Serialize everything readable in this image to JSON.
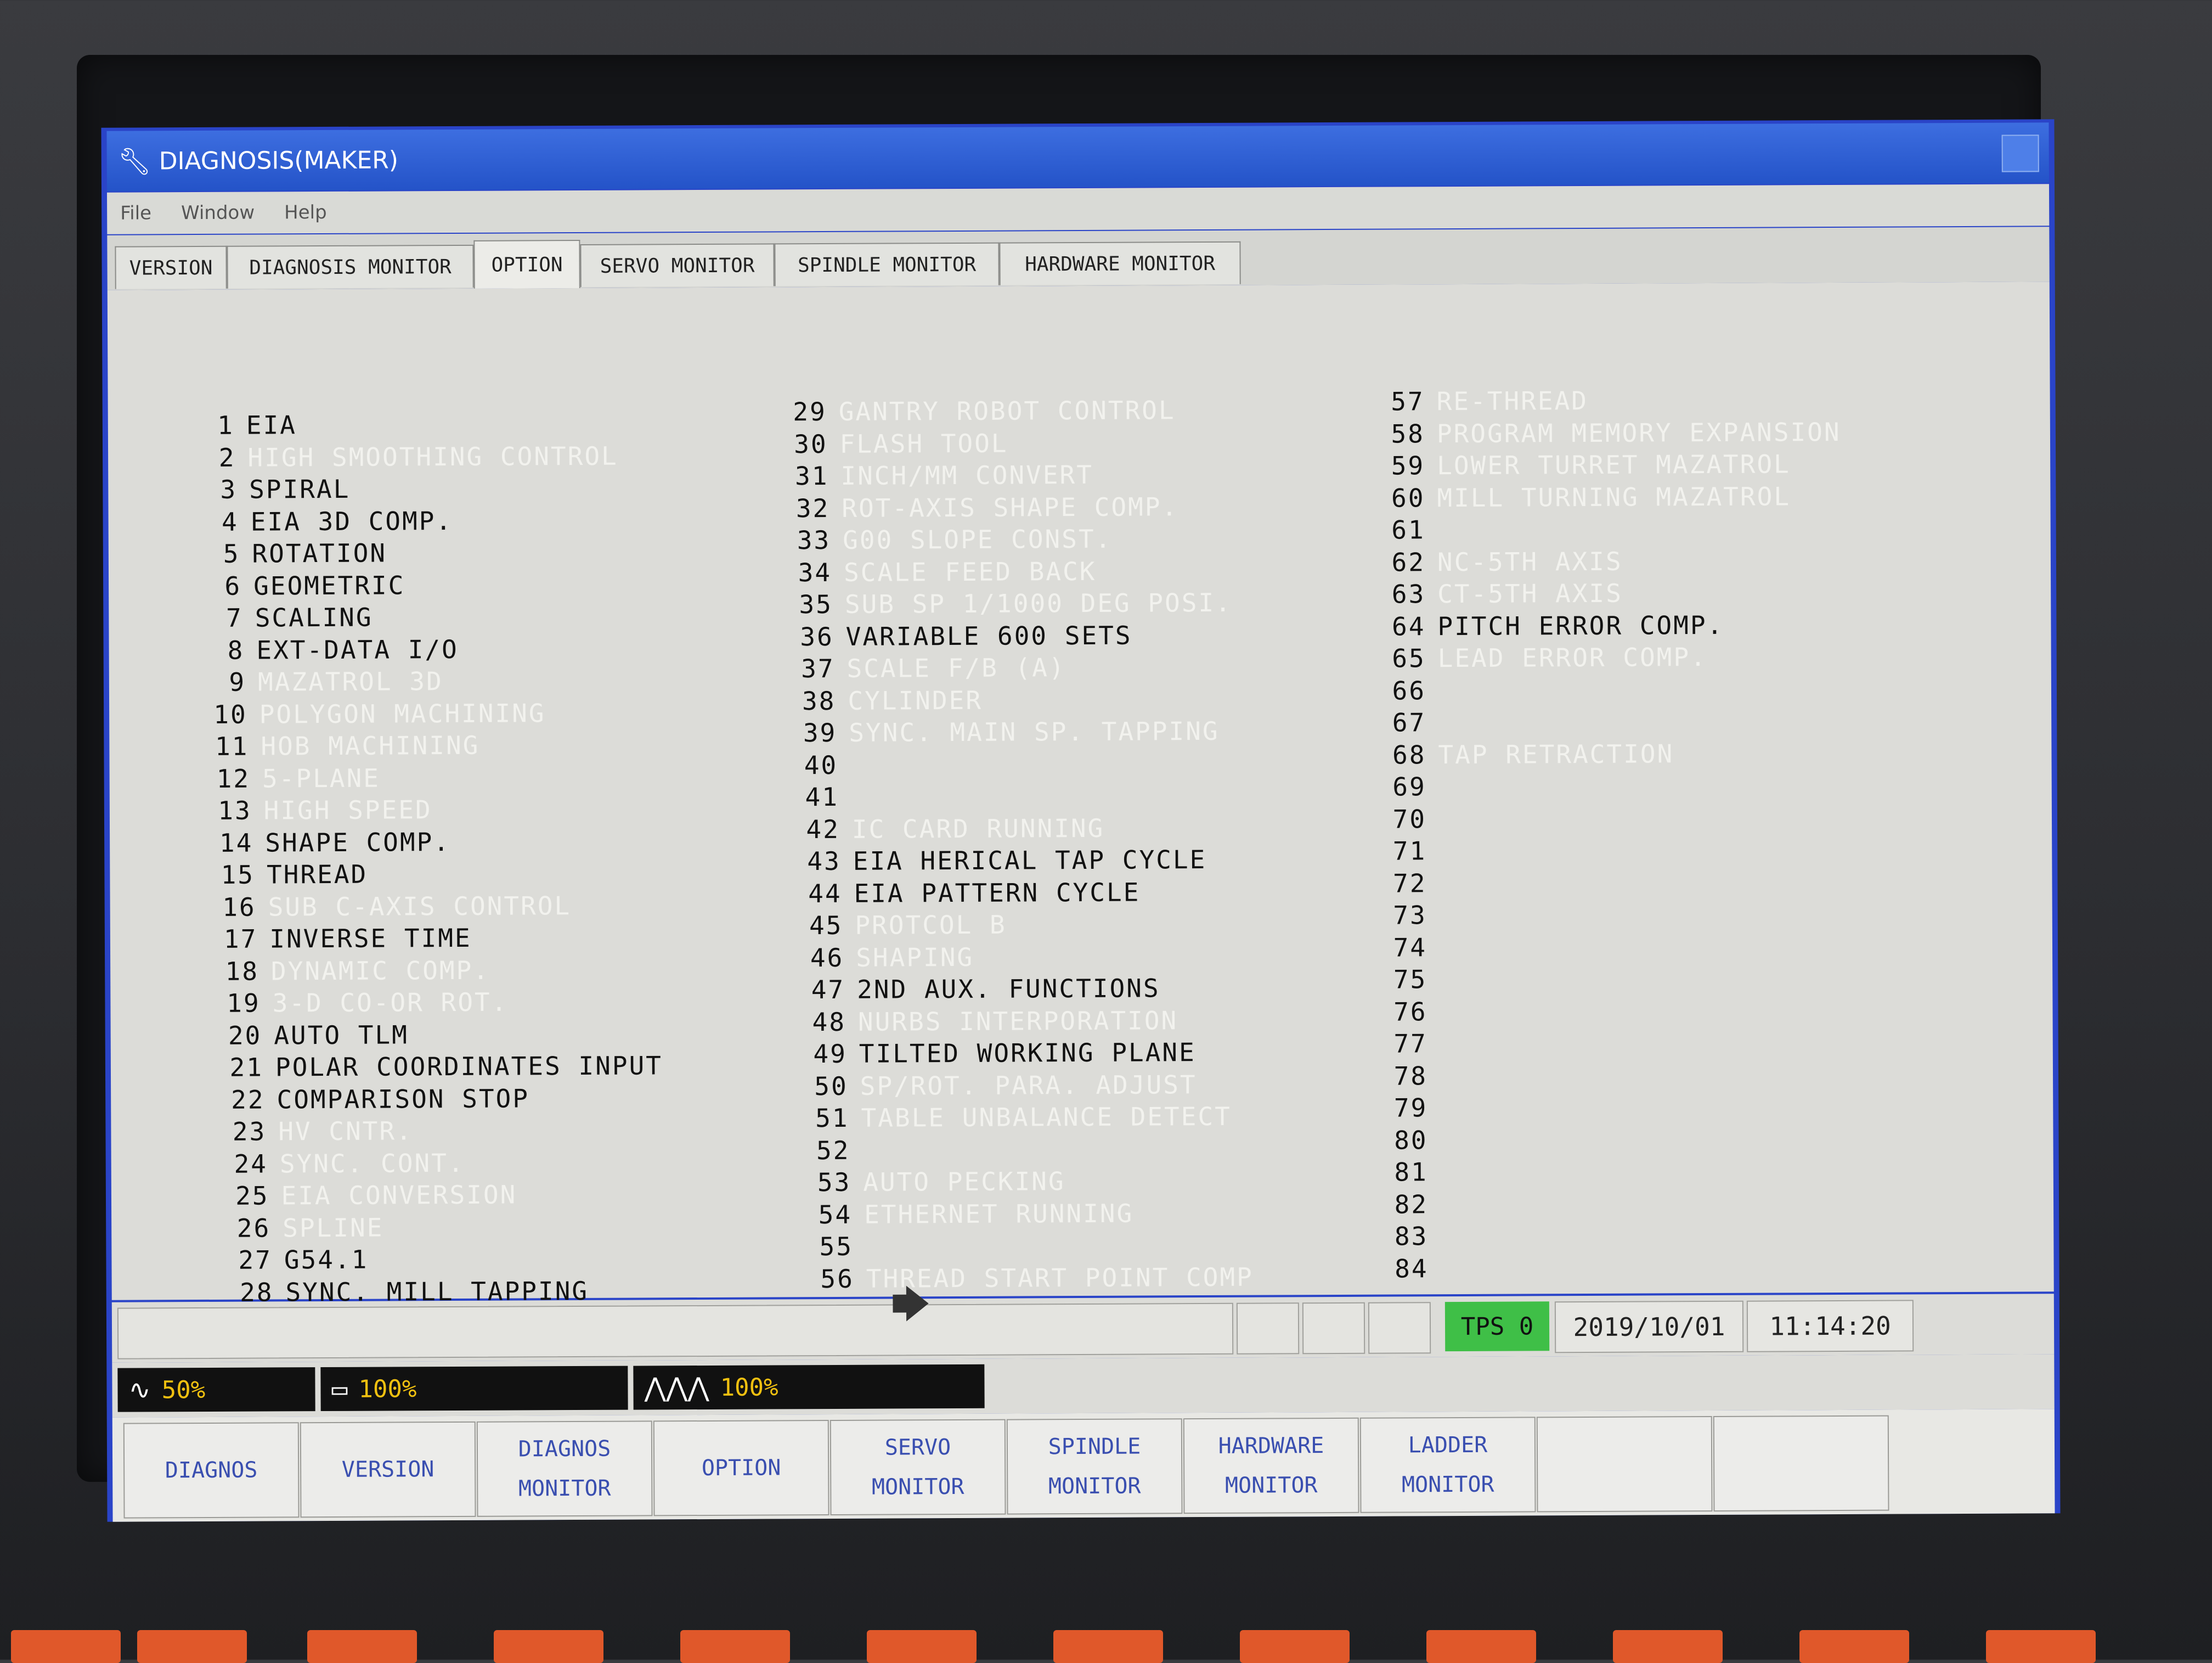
{
  "window": {
    "title": "DIAGNOSIS(MAKER)",
    "icon": "wrench-icon"
  },
  "menu": [
    "File",
    "Window",
    "Help"
  ],
  "tabs": [
    {
      "label": "VERSION",
      "active": false
    },
    {
      "label": "DIAGNOSIS MONITOR",
      "active": false
    },
    {
      "label": "OPTION",
      "active": true
    },
    {
      "label": "SERVO MONITOR",
      "active": false
    },
    {
      "label": "SPINDLE MONITOR",
      "active": false
    },
    {
      "label": "HARDWARE MONITOR",
      "active": false
    }
  ],
  "options": [
    {
      "num": "1",
      "label": "EIA",
      "enabled": true
    },
    {
      "num": "2",
      "label": "HIGH SMOOTHING CONTROL",
      "enabled": false
    },
    {
      "num": "3",
      "label": "SPIRAL",
      "enabled": true
    },
    {
      "num": "4",
      "label": "EIA 3D COMP.",
      "enabled": true
    },
    {
      "num": "5",
      "label": "ROTATION",
      "enabled": true
    },
    {
      "num": "6",
      "label": "GEOMETRIC",
      "enabled": true
    },
    {
      "num": "7",
      "label": "SCALING",
      "enabled": true
    },
    {
      "num": "8",
      "label": "EXT-DATA I/O",
      "enabled": true
    },
    {
      "num": "9",
      "label": "MAZATROL 3D",
      "enabled": false
    },
    {
      "num": "10",
      "label": "POLYGON MACHINING",
      "enabled": false
    },
    {
      "num": "11",
      "label": "HOB MACHINING",
      "enabled": false
    },
    {
      "num": "12",
      "label": "5-PLANE",
      "enabled": false
    },
    {
      "num": "13",
      "label": "HIGH SPEED",
      "enabled": false
    },
    {
      "num": "14",
      "label": "SHAPE COMP.",
      "enabled": true
    },
    {
      "num": "15",
      "label": "THREAD",
      "enabled": true
    },
    {
      "num": "16",
      "label": "SUB C-AXIS CONTROL",
      "enabled": false
    },
    {
      "num": "17",
      "label": "INVERSE TIME",
      "enabled": true
    },
    {
      "num": "18",
      "label": "DYNAMIC COMP.",
      "enabled": false
    },
    {
      "num": "19",
      "label": "3-D CO-OR ROT.",
      "enabled": false
    },
    {
      "num": "20",
      "label": "AUTO TLM",
      "enabled": true
    },
    {
      "num": "21",
      "label": "POLAR COORDINATES INPUT",
      "enabled": true
    },
    {
      "num": "22",
      "label": "COMPARISON STOP",
      "enabled": true
    },
    {
      "num": "23",
      "label": "HV CNTR.",
      "enabled": false
    },
    {
      "num": "24",
      "label": "SYNC. CONT.",
      "enabled": false
    },
    {
      "num": "25",
      "label": "EIA CONVERSION",
      "enabled": false
    },
    {
      "num": "26",
      "label": "SPLINE",
      "enabled": false
    },
    {
      "num": "27",
      "label": "G54.1",
      "enabled": true
    },
    {
      "num": "28",
      "label": "SYNC. MILL TAPPING",
      "enabled": true
    },
    {
      "num": "29",
      "label": "GANTRY ROBOT CONTROL",
      "enabled": false
    },
    {
      "num": "30",
      "label": "FLASH TOOL",
      "enabled": false
    },
    {
      "num": "31",
      "label": "INCH/MM CONVERT",
      "enabled": false
    },
    {
      "num": "32",
      "label": "ROT-AXIS SHAPE COMP.",
      "enabled": false
    },
    {
      "num": "33",
      "label": "G00 SLOPE CONST.",
      "enabled": false
    },
    {
      "num": "34",
      "label": "SCALE FEED BACK",
      "enabled": false
    },
    {
      "num": "35",
      "label": "SUB SP 1/1000 DEG POSI.",
      "enabled": false
    },
    {
      "num": "36",
      "label": "VARIABLE 600 SETS",
      "enabled": true
    },
    {
      "num": "37",
      "label": "SCALE F/B (A)",
      "enabled": false
    },
    {
      "num": "38",
      "label": "CYLINDER",
      "enabled": false
    },
    {
      "num": "39",
      "label": "SYNC. MAIN SP. TAPPING",
      "enabled": false
    },
    {
      "num": "40",
      "label": "",
      "enabled": false
    },
    {
      "num": "41",
      "label": "",
      "enabled": false
    },
    {
      "num": "42",
      "label": "IC CARD RUNNING",
      "enabled": false
    },
    {
      "num": "43",
      "label": "EIA HERICAL TAP CYCLE",
      "enabled": true
    },
    {
      "num": "44",
      "label": "EIA PATTERN CYCLE",
      "enabled": true
    },
    {
      "num": "45",
      "label": "PROTCOL B",
      "enabled": false
    },
    {
      "num": "46",
      "label": "SHAPING",
      "enabled": false
    },
    {
      "num": "47",
      "label": "2ND AUX. FUNCTIONS",
      "enabled": true
    },
    {
      "num": "48",
      "label": "NURBS INTERPORATION",
      "enabled": false
    },
    {
      "num": "49",
      "label": "TILTED WORKING PLANE",
      "enabled": true
    },
    {
      "num": "50",
      "label": "SP/ROT. PARA. ADJUST",
      "enabled": false
    },
    {
      "num": "51",
      "label": "TABLE UNBALANCE DETECT",
      "enabled": false
    },
    {
      "num": "52",
      "label": "",
      "enabled": false
    },
    {
      "num": "53",
      "label": "AUTO PECKING",
      "enabled": false
    },
    {
      "num": "54",
      "label": "ETHERNET RUNNING",
      "enabled": false
    },
    {
      "num": "55",
      "label": "",
      "enabled": false
    },
    {
      "num": "56",
      "label": "THREAD START POINT COMP",
      "enabled": false
    },
    {
      "num": "57",
      "label": "RE-THREAD",
      "enabled": false
    },
    {
      "num": "58",
      "label": "PROGRAM MEMORY EXPANSION",
      "enabled": false
    },
    {
      "num": "59",
      "label": "LOWER TURRET MAZATROL",
      "enabled": false
    },
    {
      "num": "60",
      "label": "MILL TURNING MAZATROL",
      "enabled": false
    },
    {
      "num": "61",
      "label": "",
      "enabled": false
    },
    {
      "num": "62",
      "label": "NC-5TH AXIS",
      "enabled": false
    },
    {
      "num": "63",
      "label": "CT-5TH AXIS",
      "enabled": false
    },
    {
      "num": "64",
      "label": "PITCH ERROR COMP.",
      "enabled": true
    },
    {
      "num": "65",
      "label": "LEAD ERROR COMP.",
      "enabled": false
    },
    {
      "num": "66",
      "label": "",
      "enabled": false
    },
    {
      "num": "67",
      "label": "",
      "enabled": false
    },
    {
      "num": "68",
      "label": "TAP RETRACTION",
      "enabled": false
    },
    {
      "num": "69",
      "label": "",
      "enabled": false
    },
    {
      "num": "70",
      "label": "",
      "enabled": false
    },
    {
      "num": "71",
      "label": "",
      "enabled": false
    },
    {
      "num": "72",
      "label": "",
      "enabled": false
    },
    {
      "num": "73",
      "label": "",
      "enabled": false
    },
    {
      "num": "74",
      "label": "",
      "enabled": false
    },
    {
      "num": "75",
      "label": "",
      "enabled": false
    },
    {
      "num": "76",
      "label": "",
      "enabled": false
    },
    {
      "num": "77",
      "label": "",
      "enabled": false
    },
    {
      "num": "78",
      "label": "",
      "enabled": false
    },
    {
      "num": "79",
      "label": "",
      "enabled": false
    },
    {
      "num": "80",
      "label": "",
      "enabled": false
    },
    {
      "num": "81",
      "label": "",
      "enabled": false
    },
    {
      "num": "82",
      "label": "",
      "enabled": false
    },
    {
      "num": "83",
      "label": "",
      "enabled": false
    },
    {
      "num": "84",
      "label": "",
      "enabled": false
    }
  ],
  "status": {
    "tps_label": "TPS 0",
    "tps_color": "#3fbf47",
    "date": "2019/10/01",
    "time": "11:14:20"
  },
  "meters": [
    {
      "icon": "spindle-wave-icon",
      "value": "50%"
    },
    {
      "icon": "feed-icon",
      "value": "100%"
    },
    {
      "icon": "rapid-zigzag-icon",
      "value": "100%"
    }
  ],
  "softkeys": [
    {
      "line1": "DIAGNOS",
      "line2": ""
    },
    {
      "line1": "VERSION",
      "line2": ""
    },
    {
      "line1": "DIAGNOS",
      "line2": "MONITOR"
    },
    {
      "line1": "OPTION",
      "line2": ""
    },
    {
      "line1": "SERVO",
      "line2": "MONITOR"
    },
    {
      "line1": "SPINDLE",
      "line2": "MONITOR"
    },
    {
      "line1": "HARDWARE",
      "line2": "MONITOR"
    },
    {
      "line1": "LADDER",
      "line2": "MONITOR"
    },
    {
      "line1": "",
      "line2": ""
    },
    {
      "line1": "",
      "line2": ""
    }
  ],
  "colors": {
    "window_blue": "#2a44c8",
    "enabled_text": "#111111",
    "disabled_text": "#f2f2ee",
    "softkey_text": "#3a4fb0",
    "meter_text": "#f0c010"
  }
}
